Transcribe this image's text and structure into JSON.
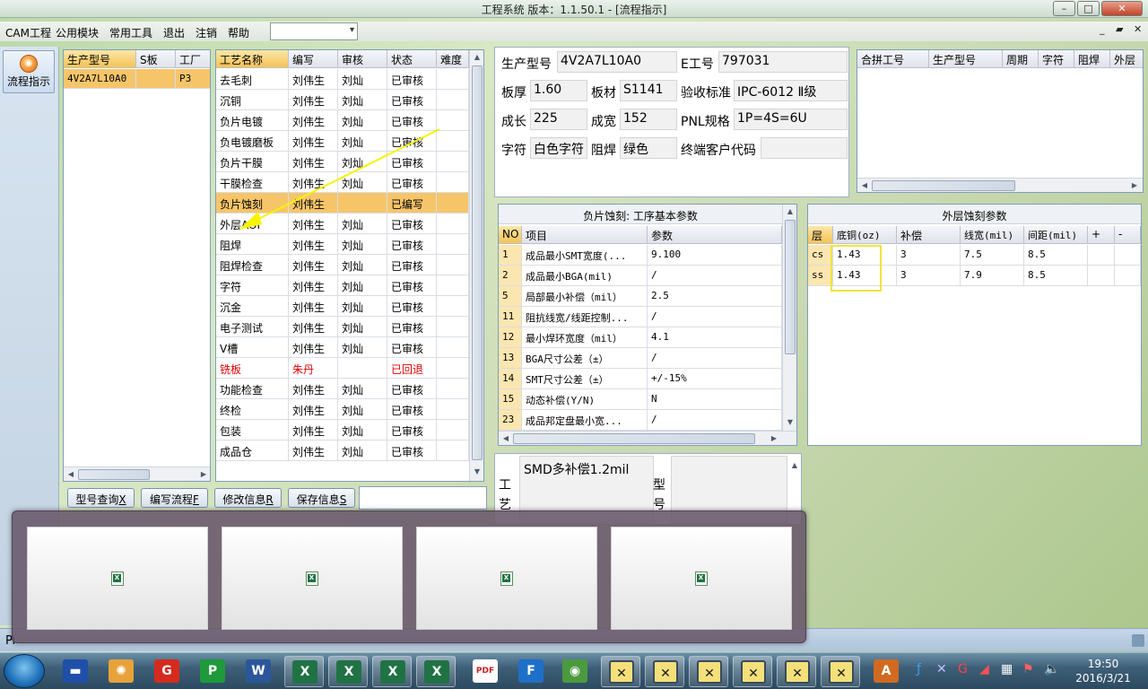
{
  "window": {
    "title": "工程系统   版本：1.1.50.1 - [流程指示]",
    "min": "–",
    "max": "□",
    "close": "✕"
  },
  "menu": {
    "items": [
      "CAM工程",
      "公用模块",
      "常用工具",
      "退出",
      "注销",
      "帮助"
    ],
    "mdi": [
      "_",
      "▰",
      "✕"
    ]
  },
  "left_panel": {
    "flow_button": "流程指示"
  },
  "models_grid": {
    "headers": [
      "生产型号",
      "S板",
      "工厂"
    ],
    "rows": [
      [
        "4V2A7L10A0",
        "",
        "P3"
      ]
    ]
  },
  "process_grid": {
    "headers": [
      "工艺名称",
      "编写",
      "审核",
      "状态",
      "难度"
    ],
    "rows": [
      [
        "去毛刺",
        "刘伟生",
        "刘灿",
        "已审核",
        ""
      ],
      [
        "沉铜",
        "刘伟生",
        "刘灿",
        "已审核",
        ""
      ],
      [
        "负片电镀",
        "刘伟生",
        "刘灿",
        "已审核",
        ""
      ],
      [
        "负电镀磨板",
        "刘伟生",
        "刘灿",
        "已审核",
        ""
      ],
      [
        "负片干膜",
        "刘伟生",
        "刘灿",
        "已审核",
        ""
      ],
      [
        "干膜检查",
        "刘伟生",
        "刘灿",
        "已审核",
        ""
      ],
      [
        "负片蚀刻",
        "刘伟生",
        "",
        "已编写",
        ""
      ],
      [
        "外层AOI",
        "刘伟生",
        "刘灿",
        "已审核",
        ""
      ],
      [
        "阻焊",
        "刘伟生",
        "刘灿",
        "已审核",
        ""
      ],
      [
        "阻焊检查",
        "刘伟生",
        "刘灿",
        "已审核",
        ""
      ],
      [
        "字符",
        "刘伟生",
        "刘灿",
        "已审核",
        ""
      ],
      [
        "沉金",
        "刘伟生",
        "刘灿",
        "已审核",
        ""
      ],
      [
        "电子测试",
        "刘伟生",
        "刘灿",
        "已审核",
        ""
      ],
      [
        "V槽",
        "刘伟生",
        "刘灿",
        "已审核",
        ""
      ],
      [
        "铣板",
        "朱丹",
        "",
        "已回退",
        ""
      ],
      [
        "功能检查",
        "刘伟生",
        "刘灿",
        "已审核",
        ""
      ],
      [
        "终检",
        "刘伟生",
        "刘灿",
        "已审核",
        ""
      ],
      [
        "包装",
        "刘伟生",
        "刘灿",
        "已审核",
        ""
      ],
      [
        "成品仓",
        "刘伟生",
        "刘灿",
        "已审核",
        ""
      ]
    ],
    "selected_row": 6,
    "red_row": 14
  },
  "info": {
    "model_label": "生产型号",
    "model": "4V2A7L10A0",
    "eno_label": "E工号",
    "eno": "797031",
    "thick_label": "板厚",
    "thick": "1.60",
    "material_label": "板材",
    "material": "S1141",
    "standard_label": "验收标准",
    "standard": "IPC-6012 Ⅱ级",
    "length_label": "成长",
    "length": "225",
    "width_label": "成宽",
    "width": "152",
    "pnl_label": "PNL规格",
    "pnl": "1P=4S=6U",
    "char_label": "字符",
    "char": "白色字符",
    "mask_label": "阻焊",
    "mask": "绿色",
    "customer_label": "终端客户代码",
    "customer": ""
  },
  "combine_grid": {
    "headers": [
      "合拼工号",
      "生产型号",
      "周期",
      "字符",
      "阻焊",
      "外层"
    ]
  },
  "params_grid": {
    "title": "负片蚀刻: 工序基本参数",
    "headers": [
      "NO",
      "项目",
      "参数"
    ],
    "rows": [
      [
        "1",
        "成品最小SMT宽度(...",
        "9.100"
      ],
      [
        "2",
        "成品最小BGA(mil)",
        "/"
      ],
      [
        "5",
        "局部最小补偿（mil）",
        "2.5"
      ],
      [
        "11",
        "阻抗线宽/线距控制...",
        "/"
      ],
      [
        "12",
        "最小焊环宽度（mil）",
        "4.1"
      ],
      [
        "13",
        "BGA尺寸公差（±）",
        "/"
      ],
      [
        "14",
        "SMT尺寸公差（±）",
        "+/-15%"
      ],
      [
        "15",
        "动态补偿(Y/N)",
        "N"
      ],
      [
        "23",
        "成品邦定盘最小宽...",
        "/"
      ]
    ]
  },
  "etch_grid": {
    "title": "外层蚀刻参数",
    "headers": [
      "层",
      "底铜(oz)",
      "补偿",
      "线宽(mil)",
      "间距(mil)",
      "+",
      "-"
    ],
    "rows": [
      [
        "cs",
        "1.43",
        "3",
        "7.5",
        "8.5",
        "",
        ""
      ],
      [
        "ss",
        "1.43",
        "3",
        "7.9",
        "8.5",
        "",
        ""
      ]
    ]
  },
  "notes": {
    "process_label": "工艺",
    "process_text": "SMD多补偿1.2mil",
    "model_label": "型号",
    "model_text": ""
  },
  "buttons": {
    "query": "型号查询",
    "query_key": "X",
    "edit": "编写流程",
    "edit_key": "F",
    "modify": "修改信息",
    "modify_key": "R",
    "save": "保存信息",
    "save_key": "S"
  },
  "status_bar": {
    "prefix": "Pi"
  },
  "taskbar": {
    "time": "19:50",
    "date": "2016/3/21",
    "apps": [
      "save-disk",
      "shell",
      "g-app",
      "p-app",
      "word",
      "excel",
      "excel",
      "excel",
      "excel",
      "pdf",
      "f-app",
      "eye-app",
      "x-app",
      "x-app",
      "x-app",
      "x-app",
      "x-app",
      "x-app",
      "a-app"
    ]
  },
  "colors": {
    "selected_row": "#f6c56a",
    "highlight_box": "#f2e33a",
    "arrow": "#f5f500",
    "red_text": "#e00000"
  }
}
